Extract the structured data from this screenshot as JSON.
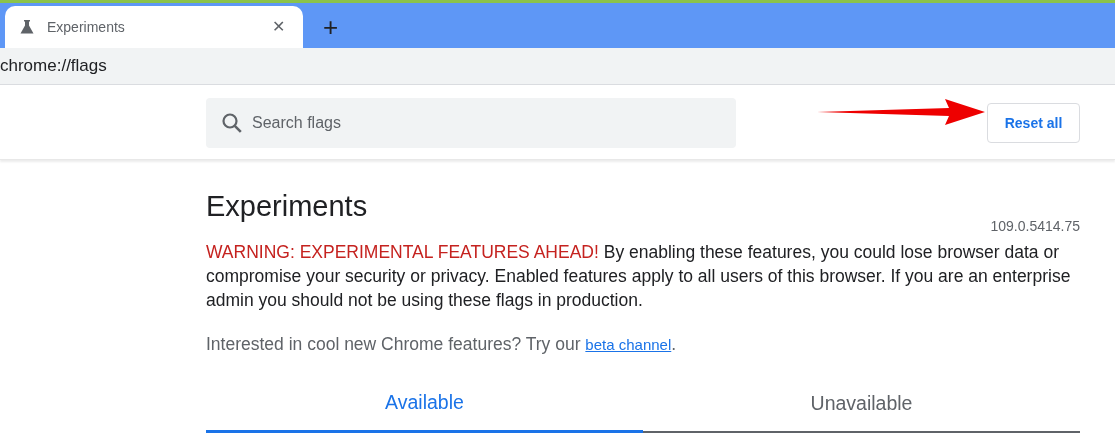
{
  "browser_tab": {
    "title": "Experiments",
    "close": "✕",
    "new_tab": "+"
  },
  "address_bar": {
    "url": "chrome://flags"
  },
  "search": {
    "placeholder": "Search flags"
  },
  "reset_button": {
    "label": "Reset all"
  },
  "title": "Experiments",
  "version": "109.0.5414.75",
  "warning": {
    "label": "WARNING: EXPERIMENTAL FEATURES AHEAD!",
    "text": " By enabling these features, you could lose browser data or compromise your security or privacy. Enabled features apply to all users of this browser. If you are an enterprise admin you should not be using these flags in production."
  },
  "promo": {
    "before": "Interested in cool new Chrome features? Try our ",
    "link": "beta channel",
    "after": "."
  },
  "tabs": [
    {
      "label": "Available",
      "selected": true
    },
    {
      "label": "Unavailable",
      "selected": false
    }
  ]
}
